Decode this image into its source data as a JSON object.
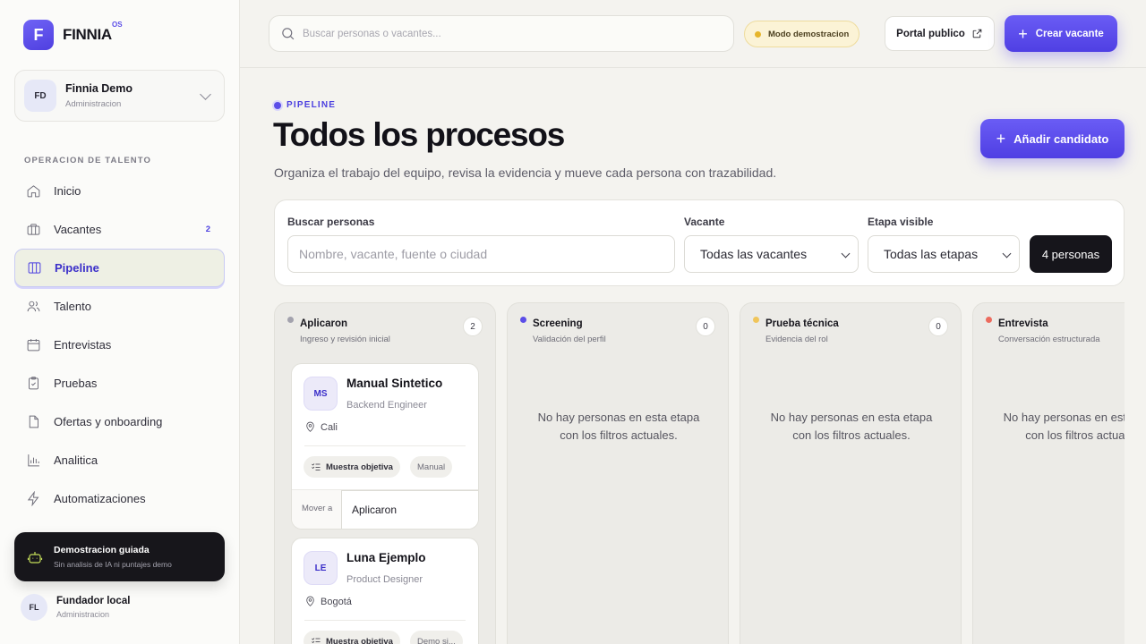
{
  "brand": {
    "initial": "F",
    "name": "FINNIA",
    "sup": "OS"
  },
  "org": {
    "initials": "FD",
    "name": "Finnia Demo",
    "role": "Administracion"
  },
  "sidebar": {
    "section_title": "OPERACION DE TALENTO",
    "items": [
      {
        "label": "Inicio",
        "icon": "home-icon"
      },
      {
        "label": "Vacantes",
        "icon": "briefcase-icon",
        "badge": "2"
      },
      {
        "label": "Pipeline",
        "icon": "columns-icon",
        "active": true
      },
      {
        "label": "Talento",
        "icon": "users-icon"
      },
      {
        "label": "Entrevistas",
        "icon": "calendar-icon"
      },
      {
        "label": "Pruebas",
        "icon": "clipboard-icon"
      },
      {
        "label": "Ofertas y onboarding",
        "icon": "file-icon"
      },
      {
        "label": "Analitica",
        "icon": "chart-icon"
      },
      {
        "label": "Automatizaciones",
        "icon": "bolt-icon"
      }
    ],
    "demo": {
      "title": "Demostracion guiada",
      "subtitle": "Sin analisis de IA ni puntajes demo"
    },
    "user": {
      "initials": "FL",
      "name": "Fundador local",
      "role": "Administracion"
    }
  },
  "topbar": {
    "search_placeholder": "Buscar personas o vacantes...",
    "demo_mode": "Modo demostracion",
    "portal_label": "Portal publico",
    "create_label": "Crear vacante"
  },
  "header": {
    "eyebrow": "PIPELINE",
    "title": "Todos los procesos",
    "subtitle": "Organiza el trabajo del equipo, revisa la evidencia y mueve cada persona con trazabilidad.",
    "add_label": "Añadir candidato"
  },
  "filters": {
    "search_label": "Buscar personas",
    "search_placeholder": "Nombre, vacante, fuente o ciudad",
    "vacancy_label": "Vacante",
    "vacancy_value": "Todas las vacantes",
    "stage_label": "Etapa visible",
    "stage_value": "Todas las etapas",
    "count": "4 personas"
  },
  "columns": [
    {
      "title": "Aplicaron",
      "subtitle": "Ingreso y revisión inicial",
      "count": "2",
      "color": "#a3a2ad"
    },
    {
      "title": "Screening",
      "subtitle": "Validación del perfil",
      "count": "0",
      "color": "#5b4de8",
      "empty": "No hay personas en esta etapa con los filtros actuales."
    },
    {
      "title": "Prueba técnica",
      "subtitle": "Evidencia del rol",
      "count": "0",
      "color": "#f0c55a",
      "empty": "No hay personas en esta etapa con los filtros actuales."
    },
    {
      "title": "Entrevista",
      "subtitle": "Conversación estructurada",
      "count": "",
      "color": "#ec6b5e",
      "empty": "No hay personas en esta etapa con los filtros actuales."
    }
  ],
  "cards": [
    {
      "initials": "MS",
      "name": "Manual Sintetico",
      "role": "Backend Engineer",
      "location": "Cali",
      "tag": "Muestra objetiva",
      "source": "Manual",
      "move_label": "Mover a",
      "move_value": "Aplicaron"
    },
    {
      "initials": "LE",
      "name": "Luna Ejemplo",
      "role": "Product Designer",
      "location": "Bogotá",
      "tag": "Muestra objetiva",
      "source": "Demo si..."
    }
  ]
}
